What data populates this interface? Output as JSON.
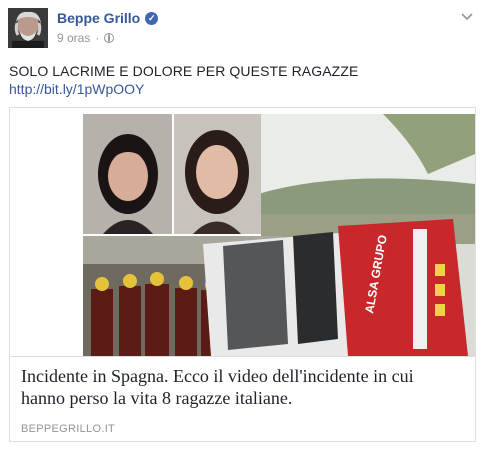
{
  "post": {
    "author": "Beppe Grillo",
    "time": "9 oras",
    "separator": "·",
    "text": "SOLO LACRIME E DOLORE PER QUESTE RAGAZZE",
    "link": "http://bit.ly/1pWpOOY"
  },
  "attachment": {
    "title": "Incidente in Spagna. Ecco il video dell'incidente in cui hanno perso la vita 8 ragazze italiane.",
    "domain": "BEPPEGRILLO.IT",
    "bus_logo_text": "ALSA GRUPO"
  },
  "icons": {
    "verified": "verified-badge-icon",
    "audience": "globe-icon",
    "menu": "chevron-down-icon"
  },
  "colors": {
    "link_blue": "#365899",
    "verified_blue": "#4267b2",
    "meta_gray": "#90949c"
  }
}
